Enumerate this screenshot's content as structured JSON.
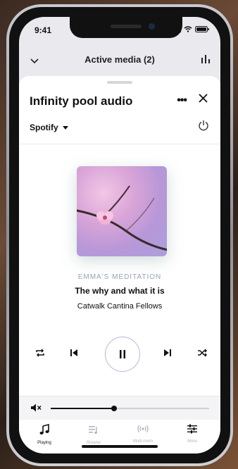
{
  "status": {
    "time": "9:41"
  },
  "header": {
    "title": "Active media (2)"
  },
  "zone": {
    "name": "Infinity pool audio",
    "more_label": "•••",
    "source": "Spotify"
  },
  "now_playing": {
    "playlist": "EMMA'S MEDITATION",
    "track": "The why and what it is",
    "artist": "Catwalk Cantina Fellows"
  },
  "volume": {
    "level": 0.4
  },
  "tabs": [
    {
      "label": "Playing",
      "icon": "music-note-icon",
      "active": true
    },
    {
      "label": "Browse",
      "icon": "browse-icon",
      "active": false
    },
    {
      "label": "Multi-room",
      "icon": "multi-room-icon",
      "active": false
    },
    {
      "label": "More",
      "icon": "sliders-icon",
      "active": false
    }
  ],
  "colors": {
    "accent": "#b9b6dc",
    "text": "#111111",
    "muted": "#9aa0b8"
  }
}
